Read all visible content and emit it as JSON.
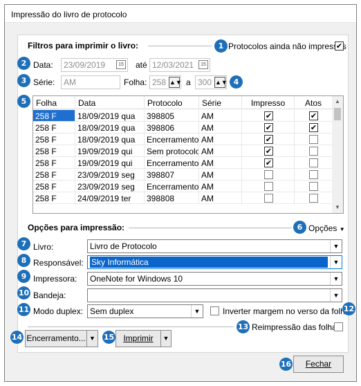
{
  "window": {
    "title": "Impressão do livro de protocolo"
  },
  "filters": {
    "title": "Filtros para imprimir o livro:",
    "only_unprinted_label": "Protocolos ainda não impressos",
    "only_unprinted_checked": true,
    "date_label": "Data:",
    "date_from": "23/09/2019",
    "date_sep": "até",
    "date_to": "12/03/2021",
    "calendar_glyph": "15",
    "serie_label": "Série:",
    "serie_value": "AM",
    "folha_label": "Folha:",
    "folha_from": "258",
    "folha_sep": "a",
    "folha_to": "300"
  },
  "grid": {
    "columns": [
      "Folha",
      "Data",
      "Protocolo",
      "Série",
      "Impresso",
      "Atos"
    ],
    "rows": [
      {
        "folha": "258 F",
        "data": "18/09/2019 qua",
        "protocolo": "398805",
        "serie": "AM",
        "impresso": true,
        "atos": true
      },
      {
        "folha": "258 F",
        "data": "18/09/2019 qua",
        "protocolo": "398806",
        "serie": "AM",
        "impresso": true,
        "atos": true
      },
      {
        "folha": "258 F",
        "data": "18/09/2019 qua",
        "protocolo": "Encerramento d",
        "serie": "AM",
        "impresso": true,
        "atos": false
      },
      {
        "folha": "258 F",
        "data": "19/09/2019 qui",
        "protocolo": "Sem protocolos",
        "serie": "AM",
        "impresso": true,
        "atos": false
      },
      {
        "folha": "258 F",
        "data": "19/09/2019 qui",
        "protocolo": "Encerramento d",
        "serie": "AM",
        "impresso": true,
        "atos": false
      },
      {
        "folha": "258 F",
        "data": "23/09/2019 seg",
        "protocolo": "398807",
        "serie": "AM",
        "impresso": false,
        "atos": false
      },
      {
        "folha": "258 F",
        "data": "23/09/2019 seg",
        "protocolo": "Encerramento d",
        "serie": "AM",
        "impresso": false,
        "atos": false
      },
      {
        "folha": "258 F",
        "data": "24/09/2019 ter",
        "protocolo": "398808",
        "serie": "AM",
        "impresso": false,
        "atos": false
      }
    ]
  },
  "options": {
    "title": "Opções para impressão:",
    "opcoes_link": "Opções",
    "livro_label": "Livro:",
    "livro_value": "Livro de Protocolo",
    "responsavel_label": "Responsável:",
    "responsavel_value": "Sky Informática",
    "impressora_label": "Impressora:",
    "impressora_value": "OneNote for Windows 10",
    "bandeja_label": "Bandeja:",
    "bandeja_value": "",
    "duplex_label": "Modo duplex:",
    "duplex_value": "Sem duplex",
    "inverter_label": "Inverter margem no verso da folha",
    "inverter_checked": false,
    "reimpressao_label": "Reimpressão das folhas",
    "reimpressao_checked": false
  },
  "buttons": {
    "encerramento": "Encerramento...",
    "imprimir": "Imprimir",
    "fechar": "Fechar"
  },
  "badges": [
    "1",
    "2",
    "3",
    "4",
    "5",
    "6",
    "7",
    "8",
    "9",
    "10",
    "11",
    "12",
    "13",
    "14",
    "15",
    "16"
  ],
  "colors": {
    "badge": "#1e6fb9",
    "selection": "#1e6fcf",
    "highlight": "#0a64c9"
  },
  "icons": {
    "check": "✔",
    "dropdown": "▼",
    "spin": "▲▼",
    "calendar": "calendar-icon",
    "scroll_up": "▲",
    "scroll_down": "▼"
  }
}
